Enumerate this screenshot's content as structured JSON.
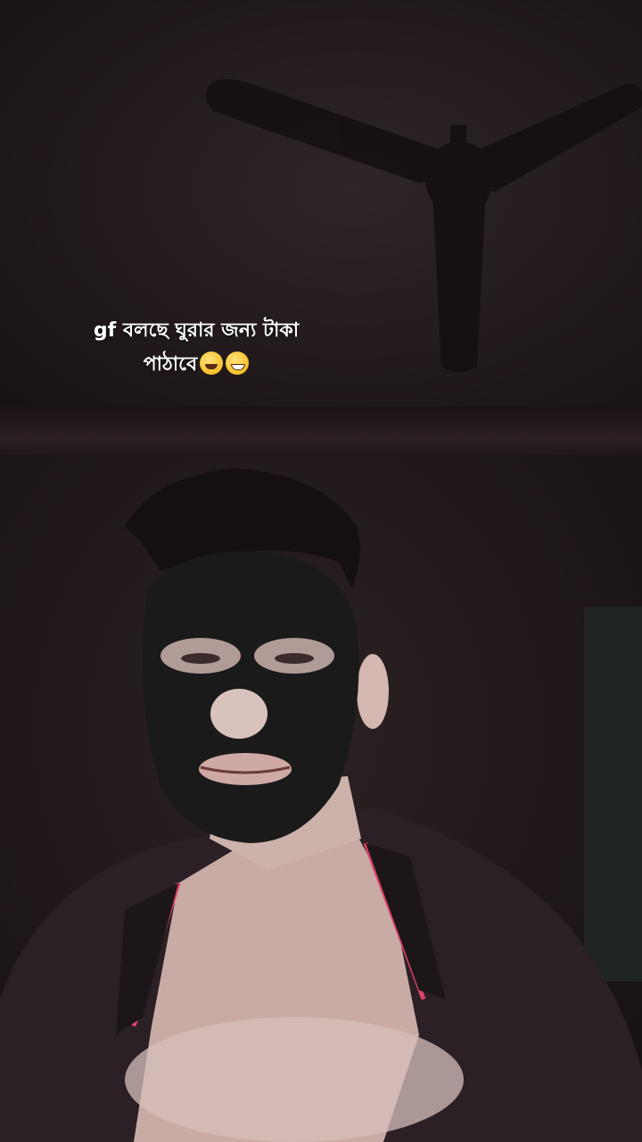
{
  "caption": {
    "line1": "gf বলছে ঘুরার জন্য টাকা",
    "line2": "পাঠাবে",
    "emojis": [
      "smiling-face-emoji",
      "grinning-face-emoji"
    ]
  },
  "colors": {
    "background": "#1d1619",
    "caption_text": "#ffffff",
    "shirt": "#2a2025",
    "shirt_piping": "#e0416a",
    "face_mask": "#1a1a1a",
    "skin": "#d9c2bc"
  }
}
